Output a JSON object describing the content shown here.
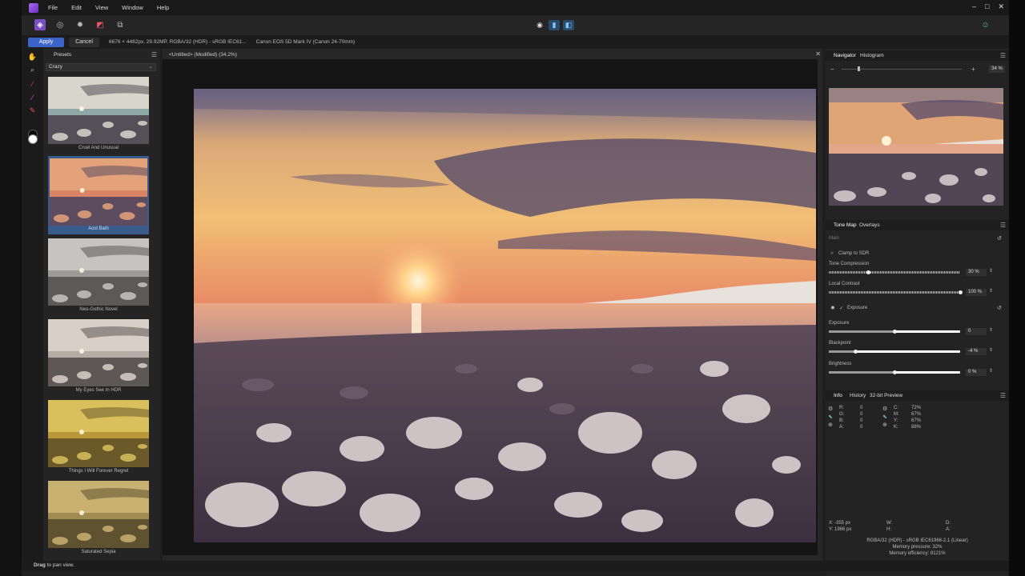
{
  "menubar": {
    "items": [
      "File",
      "Edit",
      "View",
      "Window",
      "Help"
    ]
  },
  "toolbar": {
    "personas": [
      "photo-persona-icon",
      "liquify-persona-icon",
      "develop-persona-icon",
      "tone-mapping-persona-icon",
      "export-persona-icon"
    ]
  },
  "contextbar": {
    "apply": "Apply",
    "cancel": "Cancel",
    "doc_info": "6676 × 4482px, 29.92MP, RGBA/32 (HDR) - sRGB IEC61...",
    "camera": "Canon EOS 5D Mark IV (Canon 24-70mm)"
  },
  "presets": {
    "tab": "Presets",
    "category": "Crazy",
    "items": [
      {
        "label": "Cruel And Unusual",
        "tone": "cool"
      },
      {
        "label": "Acid Bath",
        "tone": "warm",
        "selected": true
      },
      {
        "label": "Neo-Gothic Novel",
        "tone": "gray"
      },
      {
        "label": "My Eyes See In HDR",
        "tone": "cool2"
      },
      {
        "label": "Things I Will Forever Regret",
        "tone": "gold"
      },
      {
        "label": "Saturated Sepia",
        "tone": "sepia"
      }
    ]
  },
  "document": {
    "tab": "<Untitled> (Modified) (34.2%)"
  },
  "navigator": {
    "tabs": [
      "Navigator",
      "Histogram"
    ],
    "zoom": "34 %"
  },
  "tonemap": {
    "tabs": [
      "Tone Map",
      "Overlays"
    ],
    "main_label": "Main",
    "clamp_label": "Clamp to SDR",
    "exposure_section": "Exposure",
    "sliders": [
      {
        "label": "Tone Compression",
        "value": "30 %",
        "fraction": 0.3,
        "hatched": true
      },
      {
        "label": "Local Contrast",
        "value": "100 %",
        "fraction": 1.0,
        "hatched": true
      },
      {
        "label": "Exposure",
        "value": "0",
        "fraction": 0.5,
        "hatched": false
      },
      {
        "label": "Blackpoint",
        "value": "-4 %",
        "fraction": 0.2,
        "hatched": false
      },
      {
        "label": "Brightness",
        "value": "0 %",
        "fraction": 0.5,
        "hatched": false
      }
    ]
  },
  "info": {
    "tabs": [
      "Info",
      "History",
      "32-bit Preview"
    ],
    "rgba": [
      [
        "R:",
        "0"
      ],
      [
        "G:",
        "0"
      ],
      [
        "B:",
        "0"
      ],
      [
        "A:",
        "0"
      ]
    ],
    "cmyk": [
      [
        "C:",
        "72%"
      ],
      [
        "M:",
        "67%"
      ],
      [
        "Y:",
        "67%"
      ],
      [
        "K:",
        "88%"
      ]
    ],
    "pos": [
      [
        "X:",
        "-355 px"
      ],
      [
        "Y:",
        "1986 px"
      ]
    ],
    "size": [
      [
        "W:",
        ""
      ],
      [
        "H:",
        ""
      ]
    ],
    "d": [
      [
        "D:",
        ""
      ],
      [
        "A:",
        ""
      ]
    ],
    "footer": [
      "RGBA/32 (HDR) - sRGB IEC61966-2.1 (Linear)",
      "Memory pressure: 32%",
      "Memory efficiency: 8121%"
    ]
  },
  "statusbar": {
    "bold": "Drag",
    "text": " to pan view."
  },
  "colors": {
    "accent": "#3c64c8",
    "selected_preset": "#3a5c8c"
  }
}
